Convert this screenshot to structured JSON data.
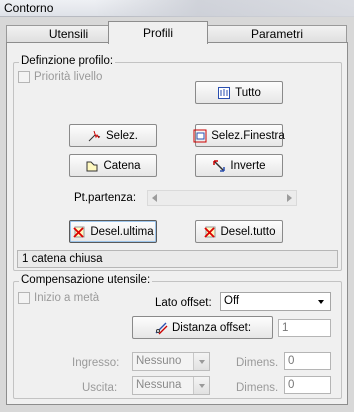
{
  "window": {
    "title": "Contorno"
  },
  "tabs": [
    {
      "label": "Utensili"
    },
    {
      "label": "Profili"
    },
    {
      "label": "Parametri"
    }
  ],
  "profile": {
    "group_title": "Definzione profilo:",
    "priority_label": "Priorità livello",
    "buttons": {
      "tutto": "Tutto",
      "selez": "Selez.",
      "selez_finestra": "Selez.Finestra",
      "catena": "Catena",
      "inverte": "Inverte",
      "desel_ultima": "Desel.ultima",
      "desel_tutto": "Desel.tutto"
    },
    "start_point_label": "Pt.partenza:",
    "status_text": "1 catena chiusa"
  },
  "compensation": {
    "group_title": "Compensazione utensile:",
    "half_start_label": "Inizio a metà",
    "side_offset_label": "Lato offset:",
    "side_offset_value": "Off",
    "distance_button": "Distanza offset:",
    "distance_value": "1",
    "entry_label": "Ingresso:",
    "entry_value": "Nessuno",
    "entry_dim_label": "Dimens.",
    "entry_dim_value": "0",
    "exit_label": "Uscita:",
    "exit_value": "Nessuna",
    "exit_dim_label": "Dimens.",
    "exit_dim_value": "0"
  }
}
